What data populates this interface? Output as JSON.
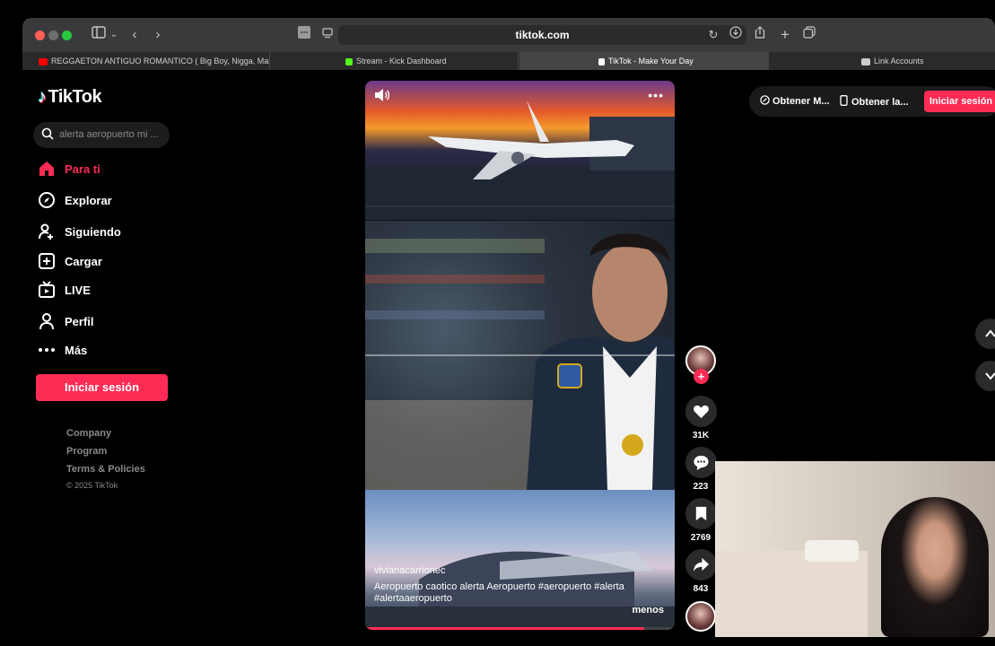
{
  "browser": {
    "url": "tiktok.com",
    "tabs": [
      {
        "label": "REGGAETON ANTIGUO ROMANTICO ( Big Boy, Nigga, Makan...",
        "icon": "youtube-icon",
        "color": "#ff0000"
      },
      {
        "label": "Stream - Kick Dashboard",
        "icon": "kick-icon",
        "color": "#53fc18"
      },
      {
        "label": "TikTok - Make Your Day",
        "icon": "tiktok-icon",
        "color": "#ffffff"
      },
      {
        "label": "Link Accounts",
        "icon": "link-icon",
        "color": "#cccccc"
      }
    ]
  },
  "sidebar": {
    "logo": "TikTok",
    "search_placeholder": "alerta aeropuerto mi ...",
    "nav": [
      {
        "label": "Para ti",
        "icon": "home-icon"
      },
      {
        "label": "Explorar",
        "icon": "compass-icon"
      },
      {
        "label": "Siguiendo",
        "icon": "following-icon"
      },
      {
        "label": "Cargar",
        "icon": "upload-icon"
      },
      {
        "label": "LIVE",
        "icon": "live-icon"
      },
      {
        "label": "Perfil",
        "icon": "profile-icon"
      },
      {
        "label": "Más",
        "icon": "more-icon"
      }
    ],
    "login_label": "Iniciar sesión",
    "footer": [
      "Company",
      "Program",
      "Terms & Policies"
    ],
    "copyright": "© 2025 TikTok"
  },
  "video": {
    "creator": "vivianacarrionec",
    "caption": "Aeropuerto caotico alerta Aeropuerto #aeropuerto #alerta #alertaaeropuerto",
    "more_label": "menos",
    "progress": 0.9
  },
  "actions": {
    "likes": "31K",
    "comments": "223",
    "saves": "2769",
    "shares": "843"
  },
  "header_right": {
    "item1": "Obtener M...",
    "item2": "Obtener la...",
    "login_label": "Iniciar sesión"
  },
  "colors": {
    "accent": "#fe2c55",
    "background": "#000000"
  }
}
